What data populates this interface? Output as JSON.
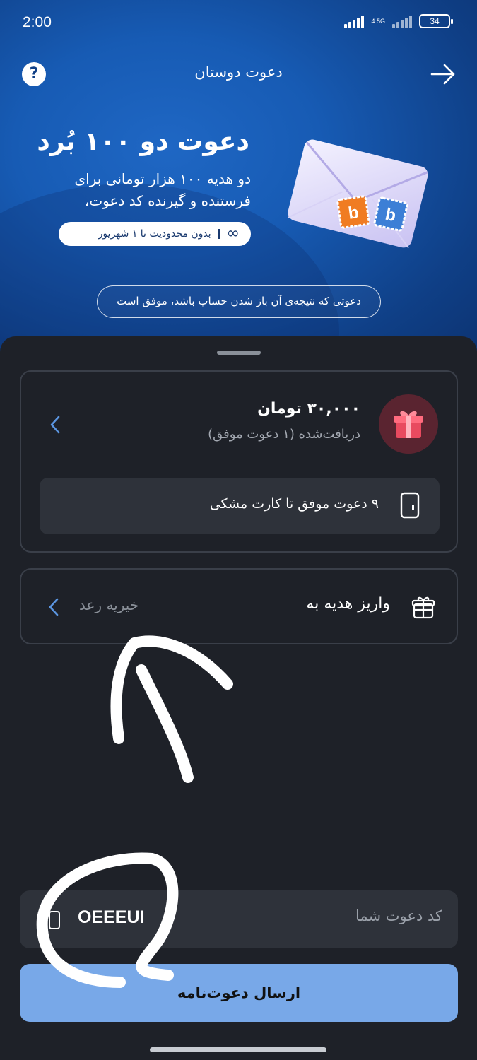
{
  "status_bar": {
    "time": "2:00",
    "network": "4.5G",
    "battery": "34"
  },
  "header": {
    "title": "دعوت دوستان",
    "help_icon": "question-mark-icon",
    "back_icon": "arrow-right-icon"
  },
  "hero": {
    "headline": "دعوت دو ۱۰۰ بُرد",
    "description": "دو هدیه ۱۰۰ هزار تومانی برای فرستنده و گیرنده کد دعوت،",
    "pill_text": "بدون محدودیت تا ۱ شهریور",
    "pill_icon": "infinity-icon",
    "note": "دعوتی که نتیجه‌ی آن باز شدن حساب باشد، موفق است",
    "envelope_badge_1": "b",
    "envelope_badge_2": "b"
  },
  "rewards_card": {
    "amount": "۳۰,۰۰۰ تومان",
    "received": "دریافت‌شده (۱ دعوت موفق)",
    "progress_label": "۹ دعوت موفق تا کارت مشکی"
  },
  "gift_card": {
    "label": "واریز هدیه به",
    "destination": "خیریه رعد"
  },
  "invite": {
    "code_label": "کد دعوت شما",
    "code_value": "OEEEUI",
    "send_button": "ارسال دعوت‌نامه"
  },
  "colors": {
    "hero_blue": "#175bb4",
    "sheet_bg": "#1e2128",
    "button_blue": "#78a8e8",
    "gift_red": "#e84a5f"
  }
}
